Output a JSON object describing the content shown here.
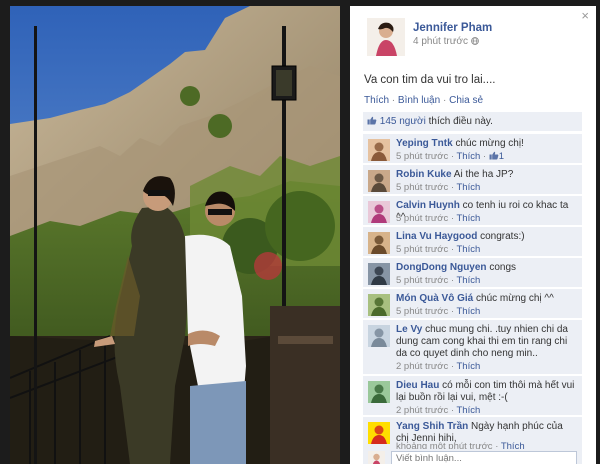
{
  "photo_viewer": {
    "close_label": "×"
  },
  "post": {
    "author": "Jennifer Pham",
    "time": "4 phút trước",
    "status": "Va con tim da vui tro lai....",
    "actions": {
      "like": "Thích",
      "comment": "Bình luận",
      "share": "Chia sẻ",
      "sep": "·"
    },
    "likes": {
      "count": "145 người",
      "suffix": " thích điều này."
    }
  },
  "comments": [
    {
      "name": "Yeping Tntk",
      "text": " chúc mừng chị!",
      "time": "5 phút trước",
      "like": "Thích",
      "likes": "1",
      "colors": [
        "#8a5a3a",
        "#e6c2a0"
      ]
    },
    {
      "name": "Robin Kuke",
      "text": " Ai the ha JP?",
      "time": "5 phút trước",
      "like": "Thích",
      "likes": "",
      "colors": [
        "#5a4a3a",
        "#c9a88a"
      ]
    },
    {
      "name": "Calvin Huynh",
      "text": " co tenh iu roi co khac ta ^^",
      "time": "5 phút trước",
      "like": "Thích",
      "likes": "",
      "colors": [
        "#b03a7a",
        "#e9c8d8"
      ]
    },
    {
      "name": "Lina Vu Haygood",
      "text": " congrats:)",
      "time": "5 phút trước",
      "like": "Thích",
      "likes": "",
      "colors": [
        "#6a4a2a",
        "#d7b38a"
      ]
    },
    {
      "name": "DongDong Nguyen",
      "text": " congs",
      "time": "5 phút trước",
      "like": "Thích",
      "likes": "",
      "colors": [
        "#303a45",
        "#8795a5"
      ]
    },
    {
      "name": "Món Quà Vô Giá",
      "text": " chúc mừng chị ^^",
      "time": "5 phút trước",
      "like": "Thích",
      "likes": "",
      "colors": [
        "#4a6a2a",
        "#a8c080"
      ]
    },
    {
      "name": "Le Vy",
      "text": " chuc mung chi. .tuy nhien chi da dung cam cong khai thi em tin rang chi da co quyet dinh cho neng min..",
      "time": "2 phút trước",
      "like": "Thích",
      "likes": "",
      "colors": [
        "#7a8a9a",
        "#c8d4e0"
      ]
    },
    {
      "name": "Dieu Hau",
      "text": " có mỗi con tim thôi mà hết vui lại buồn rồi lại vui, mệt :-(",
      "time": "2 phút trước",
      "like": "Thích",
      "likes": "",
      "colors": [
        "#3a6a3a",
        "#9ac89a"
      ]
    },
    {
      "name": "Yang Shih Trần",
      "text": " Ngày hạnh phúc của chị Jenni hihi,",
      "time": "khoảng một phút trước",
      "like": "Thích",
      "likes": "",
      "colors": [
        "#d52b1e",
        "#ffde00"
      ]
    }
  ],
  "write_comment": {
    "placeholder": "Viết bình luận..."
  }
}
